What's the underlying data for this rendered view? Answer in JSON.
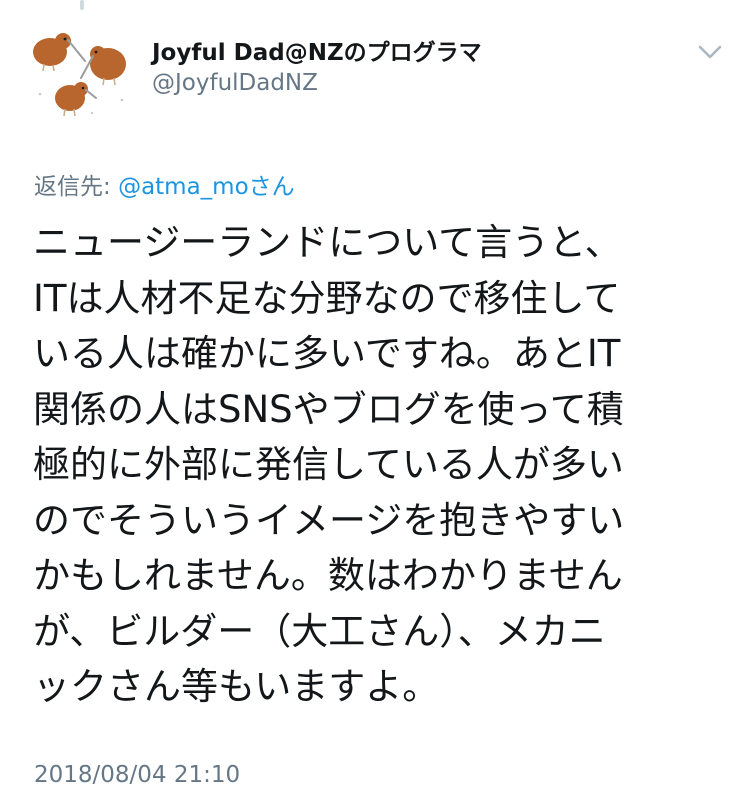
{
  "author": {
    "display_name": "Joyful Dad@NZのプログラマ",
    "handle": "@JoyfulDadNZ",
    "avatar_icon": "kiwi-birds-avatar-icon"
  },
  "menu": {
    "icon": "chevron-down-icon"
  },
  "reply": {
    "prefix": "返信先: ",
    "mention": "@atma_moさん"
  },
  "tweet": {
    "lines": [
      "ニュージーランドについて言うと、",
      "ITは人材不足な分野なので移住して",
      "いる人は確かに多いですね。あとIT",
      "関係の人はSNSやブログを使って積",
      "極的に外部に発信している人が多い",
      "のでそういうイメージを抱きやすい",
      "かもしれません。数はわかりません",
      "が、ビルダー（大工さん）、メカニ",
      "ックさん等もいますよ。"
    ],
    "timestamp": "2018/08/04 21:10"
  },
  "colors": {
    "text": "#14171a",
    "secondary": "#657786",
    "link": "#1b95e0",
    "kiwi_body": "#b8652e"
  }
}
